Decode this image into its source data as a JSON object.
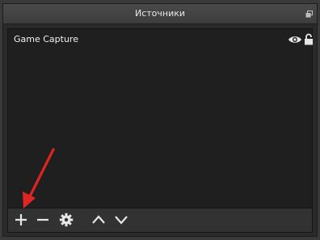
{
  "panel": {
    "title": "Источники"
  },
  "sources": {
    "items": [
      {
        "label": "Game Capture",
        "visible": true,
        "locked": false
      }
    ]
  },
  "toolbar": {
    "buttons": [
      "add-icon",
      "remove-icon",
      "settings-icon",
      "move-up-icon",
      "move-down-icon"
    ]
  },
  "annotation": {
    "arrow_color": "#e02424"
  },
  "colors": {
    "panel_bg": "#2a2a2a",
    "list_bg": "#1f1f1f",
    "text": "#f0f0f0",
    "icon": "#e0e0e0"
  }
}
